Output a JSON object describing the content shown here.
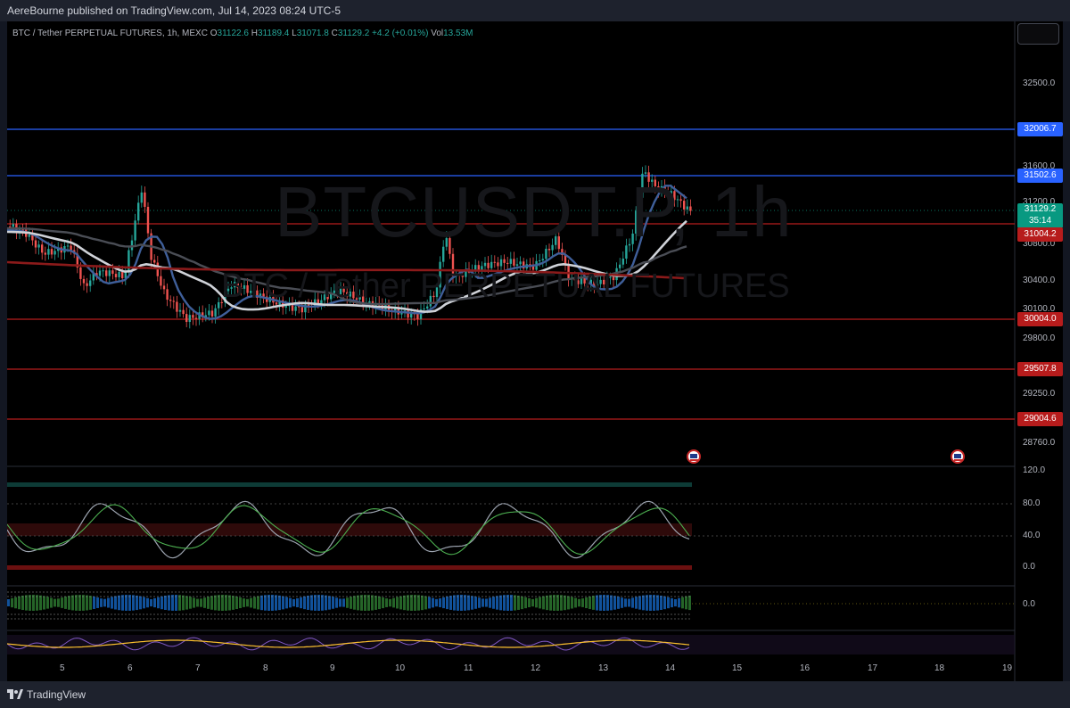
{
  "header": {
    "published": "AereBourne published on TradingView.com, Jul 14, 2023 08:24 UTC-5"
  },
  "symbol": {
    "name": "BTC / Tether PERPETUAL FUTURES, 1h, MEXC",
    "o_label": "O",
    "o": "31122.6",
    "h_label": "H",
    "h": "31189.4",
    "l_label": "L",
    "l": "31071.8",
    "c_label": "C",
    "c": "31129.2",
    "change": "+4.2 (+0.01%)",
    "vol_label": "Vol",
    "vol": "13.53M"
  },
  "watermark": {
    "ticker": "BTCUSDT.P, 1h",
    "description": "BTC / Tether PERPETUAL FUTURES"
  },
  "price_axis": {
    "ticks": [
      "32500.0",
      "31600.0",
      "31200.0",
      "30800.0",
      "30400.0",
      "30100.0",
      "29800.0",
      "29250.0",
      "28760.0"
    ],
    "indicator1_ticks": [
      "120.0",
      "80.0",
      "40.0",
      "0.0"
    ],
    "indicator2_ticks": [
      "0.0"
    ]
  },
  "levels": [
    {
      "label": "32006.7",
      "color": "#2962ff"
    },
    {
      "label": "31502.6",
      "color": "#2962ff"
    },
    {
      "label": "31004.2",
      "color": "#b71c1c"
    },
    {
      "label": "30004.0",
      "color": "#b71c1c"
    },
    {
      "label": "29507.8",
      "color": "#b71c1c"
    },
    {
      "label": "29004.6",
      "color": "#b71c1c"
    }
  ],
  "current_price": {
    "value": "31129.2",
    "countdown": "35:14",
    "color": "#089981"
  },
  "time_axis": [
    "5",
    "6",
    "7",
    "8",
    "9",
    "10",
    "11",
    "12",
    "13",
    "14",
    "15",
    "16",
    "17",
    "18",
    "19"
  ],
  "footer": {
    "brand": "TradingView"
  },
  "colors": {
    "up": "#26a69a",
    "down": "#ef5350",
    "ma_blue": "#4a6fa5",
    "ma_white": "#d1d4dc",
    "ma_red": "#8b1a1a",
    "background": "#000000"
  },
  "icons": {
    "flag": "us-flag-icon",
    "logo": "tradingview-logo-icon"
  }
}
